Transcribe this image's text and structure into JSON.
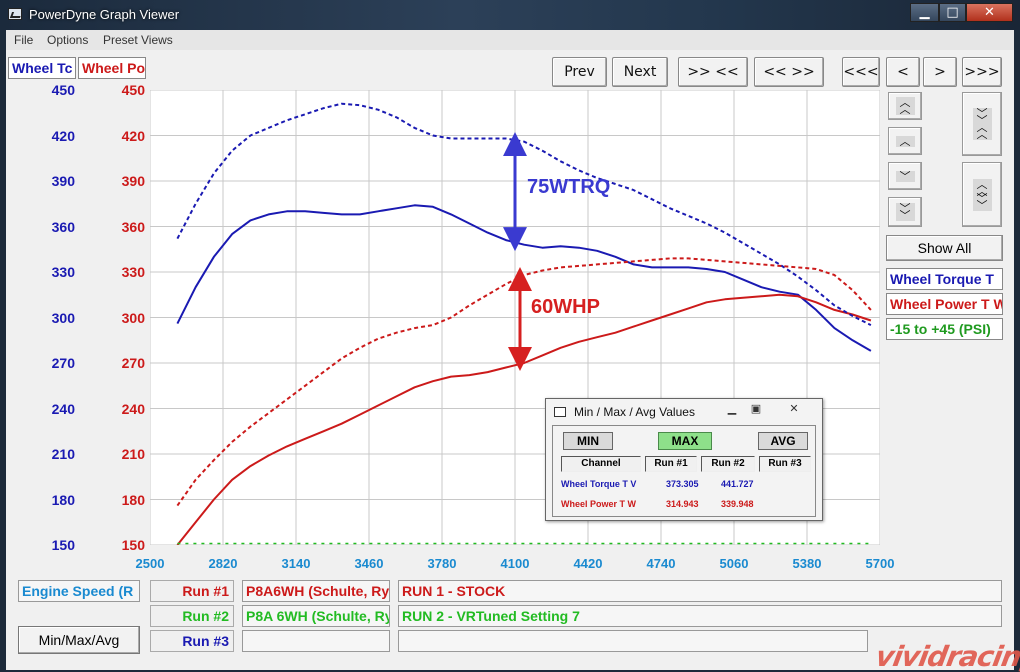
{
  "window": {
    "title": "PowerDyne Graph Viewer"
  },
  "menu": [
    "File",
    "Options",
    "Preset Views"
  ],
  "tabs": {
    "torque": "Wheel Tc",
    "power": "Wheel Po"
  },
  "nav": {
    "prev": "Prev",
    "next": "Next",
    "zoom_in": ">> <<",
    "zoom_out": "<< >>",
    "first": "<<<",
    "back": "<",
    "fwd": ">",
    "last": ">>>"
  },
  "side_buttons": {
    "up_fast": "^^",
    "up": "^",
    "down": "v",
    "down_fast": "vv",
    "big_up": "vv^^",
    "big_down": "^^vv"
  },
  "show_all": "Show All",
  "legend": {
    "torque": "Wheel Torque T",
    "power": "Wheel Power T W",
    "boost": "-15 to +45 (PSI)"
  },
  "bottom": {
    "engine_speed": "Engine Speed (R",
    "run1_label": "Run #1",
    "run2_label": "Run #2",
    "run3_label": "Run #3",
    "run1_vehicle": "P8A6WH (Schulte, Ry",
    "run2_vehicle": "P8A 6WH (Schulte, Ry",
    "run1_desc": "RUN 1 - STOCK",
    "run2_desc": "RUN 2 - VRTuned Setting 7",
    "mma_button": "Min/Max/Avg"
  },
  "annotations": {
    "torque_gain": "75WTRQ",
    "power_gain": "60WHP"
  },
  "popup": {
    "title": "Min / Max / Avg Values",
    "min": "MIN",
    "max": "MAX",
    "avg": "AVG",
    "headers": [
      "Channel",
      "Run #1",
      "Run #2",
      "Run #3"
    ],
    "rows": [
      {
        "channel": "Wheel Torque T V",
        "run1": "373.305",
        "run2": "441.727",
        "run3": ""
      },
      {
        "channel": "Wheel Power T W",
        "run1": "314.943",
        "run2": "339.948",
        "run3": ""
      }
    ]
  },
  "watermark": "vividracing",
  "colors": {
    "torque": "#1a1ab2",
    "power": "#cc1a1a",
    "run2": "#22bb22",
    "xaxis": "#1a8ad0"
  },
  "chart_data": {
    "type": "line",
    "x_ticks": [
      2500,
      2820,
      3140,
      3460,
      3780,
      4100,
      4420,
      4740,
      5060,
      5380,
      5700
    ],
    "y_left_ticks": [
      150,
      180,
      210,
      240,
      270,
      300,
      330,
      360,
      390,
      420,
      450
    ],
    "y_right_ticks": [
      150,
      180,
      210,
      240,
      270,
      300,
      330,
      360,
      390,
      420,
      450
    ],
    "xlim": [
      2500,
      5700
    ],
    "ylim": [
      150,
      450
    ],
    "grid": true,
    "series": [
      {
        "name": "Wheel Torque T",
        "run": "Run #1",
        "style": "solid",
        "color": "#1a1ab2",
        "x": [
          2620,
          2700,
          2780,
          2860,
          2940,
          3020,
          3100,
          3180,
          3260,
          3340,
          3420,
          3500,
          3580,
          3660,
          3740,
          3820,
          3900,
          3980,
          4060,
          4140,
          4220,
          4300,
          4380,
          4460,
          4540,
          4620,
          4700,
          4780,
          4860,
          4940,
          5020,
          5100,
          5180,
          5260,
          5340,
          5420,
          5500,
          5580,
          5660
        ],
        "y": [
          296,
          320,
          340,
          355,
          364,
          368,
          370,
          370,
          369,
          368,
          368,
          370,
          372,
          374,
          373,
          368,
          362,
          356,
          351,
          348,
          346,
          347,
          346,
          344,
          340,
          335,
          333,
          333,
          333,
          332,
          330,
          325,
          320,
          317,
          315,
          305,
          293,
          285,
          278
        ]
      },
      {
        "name": "Wheel Power T W",
        "run": "Run #1",
        "style": "solid",
        "color": "#cc1a1a",
        "x": [
          2620,
          2700,
          2780,
          2860,
          2940,
          3020,
          3100,
          3180,
          3260,
          3340,
          3420,
          3500,
          3580,
          3660,
          3740,
          3820,
          3900,
          3980,
          4060,
          4140,
          4220,
          4300,
          4380,
          4460,
          4540,
          4620,
          4700,
          4780,
          4860,
          4940,
          5020,
          5100,
          5180,
          5260,
          5340,
          5420,
          5500,
          5580,
          5660
        ],
        "y": [
          150,
          165,
          180,
          193,
          202,
          209,
          215,
          220,
          225,
          230,
          236,
          242,
          248,
          254,
          258,
          261,
          262,
          264,
          267,
          270,
          275,
          280,
          284,
          287,
          290,
          294,
          298,
          302,
          306,
          310,
          312,
          313,
          314,
          315,
          314,
          310,
          305,
          302,
          298
        ]
      },
      {
        "name": "Wheel Torque T",
        "run": "Run #2",
        "style": "dashed",
        "color": "#1a1ab2",
        "x": [
          2620,
          2700,
          2780,
          2860,
          2940,
          3020,
          3100,
          3180,
          3260,
          3340,
          3420,
          3500,
          3580,
          3660,
          3740,
          3820,
          3900,
          3980,
          4060,
          4140,
          4220,
          4300,
          4380,
          4460,
          4540,
          4620,
          4700,
          4780,
          4860,
          4940,
          5020,
          5100,
          5180,
          5260,
          5340,
          5420,
          5500,
          5580,
          5660
        ],
        "y": [
          352,
          375,
          395,
          410,
          420,
          425,
          430,
          434,
          438,
          441,
          440,
          437,
          432,
          425,
          420,
          418,
          418,
          418,
          418,
          416,
          410,
          403,
          397,
          392,
          388,
          384,
          378,
          372,
          367,
          362,
          356,
          349,
          342,
          335,
          327,
          318,
          308,
          301,
          295
        ]
      },
      {
        "name": "Wheel Power T W",
        "run": "Run #2",
        "style": "dashed",
        "color": "#cc1a1a",
        "x": [
          2620,
          2700,
          2780,
          2860,
          2940,
          3020,
          3100,
          3180,
          3260,
          3340,
          3420,
          3500,
          3580,
          3660,
          3740,
          3820,
          3900,
          3980,
          4060,
          4140,
          4220,
          4300,
          4380,
          4460,
          4540,
          4620,
          4700,
          4780,
          4860,
          4940,
          5020,
          5100,
          5180,
          5260,
          5340,
          5420,
          5500,
          5580,
          5660
        ],
        "y": [
          176,
          193,
          206,
          218,
          228,
          237,
          246,
          255,
          264,
          273,
          280,
          286,
          290,
          293,
          295,
          300,
          308,
          315,
          322,
          328,
          331,
          333,
          334,
          335,
          336,
          337,
          338,
          339,
          339,
          338,
          337,
          336,
          335,
          334,
          333,
          332,
          328,
          318,
          305
        ]
      },
      {
        "name": "-15 to +45 (PSI)",
        "run": "Run #2",
        "style": "dotted",
        "color": "#22bb22",
        "x": [
          2620,
          5660
        ],
        "y": [
          151,
          151
        ]
      }
    ]
  }
}
